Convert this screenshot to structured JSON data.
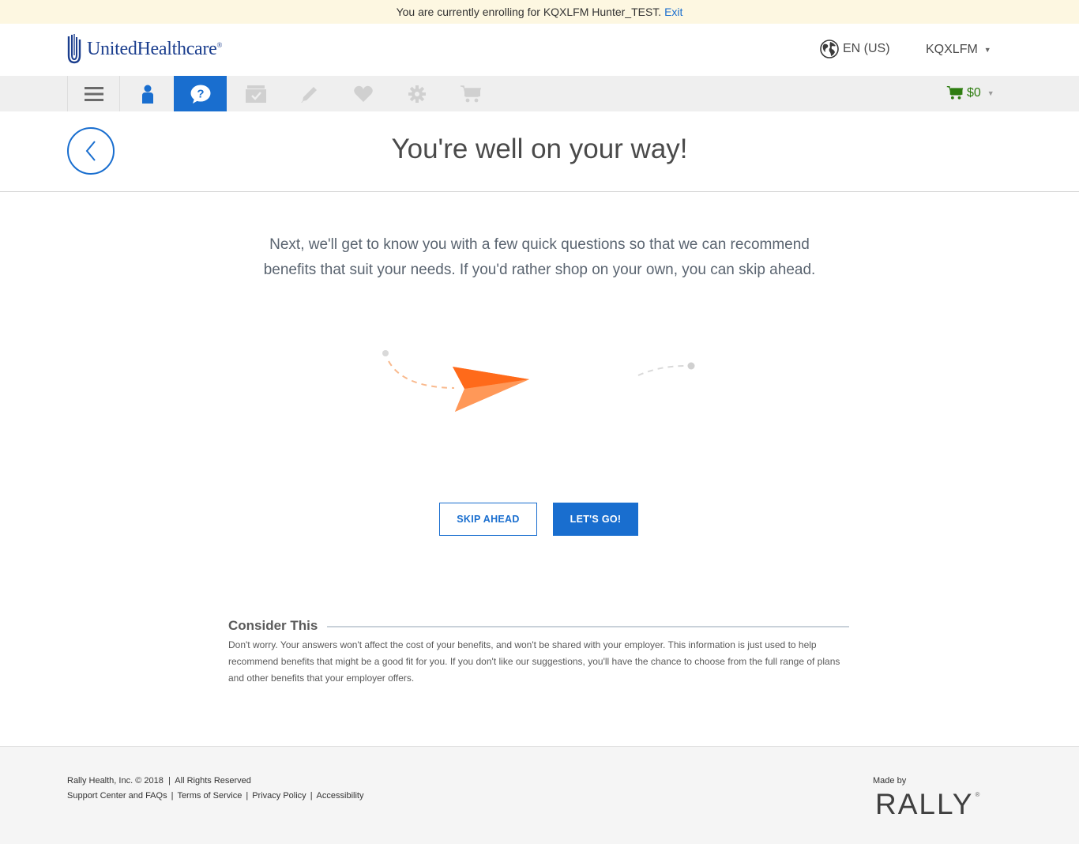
{
  "banner": {
    "text": "You are currently enrolling for KQXLFM Hunter_TEST.",
    "exit_link": "Exit"
  },
  "header": {
    "logo_text": "UnitedHealthcare",
    "language": "EN (US)",
    "user_name": "KQXLFM"
  },
  "nav": {
    "items": [
      {
        "icon": "menu-icon",
        "active": false
      },
      {
        "icon": "person-icon",
        "active": false
      },
      {
        "icon": "question-chat-icon",
        "active": true
      },
      {
        "icon": "folder-check-icon",
        "active": false
      },
      {
        "icon": "pencil-icon",
        "active": false
      },
      {
        "icon": "heart-icon",
        "active": false
      },
      {
        "icon": "gear-icon",
        "active": false
      },
      {
        "icon": "cart-icon",
        "active": false
      }
    ],
    "cart_amount": "$0"
  },
  "page": {
    "title": "You're well on your way!",
    "intro": "Next, we'll get to know you with a few quick questions so that we can recommend benefits that suit your needs. If you'd rather shop on your own, you can skip ahead."
  },
  "buttons": {
    "skip_label": "SKIP AHEAD",
    "go_label": "LET'S GO!"
  },
  "consider": {
    "title": "Consider This",
    "body": "Don't worry. Your answers won't affect the cost of your benefits, and won't be shared with your employer. This information is just used to help recommend benefits that might be a good fit for you. If you don't like our suggestions, you'll have the chance to choose from the full range of plans and other benefits that your employer offers."
  },
  "footer": {
    "copyright": "Rally Health, Inc. © 2018  |  All Rights Reserved",
    "links": [
      "Support Center and FAQs",
      "Terms of Service",
      "Privacy Policy",
      "Accessibility"
    ],
    "made_by": "Made by",
    "brand": "RALLY"
  },
  "colors": {
    "primary_blue": "#196ecf",
    "banner_bg": "#fdf7e1",
    "nav_bg": "#efefef",
    "cart_green": "#2e7d10",
    "plane_orange": "#ff7a2e"
  }
}
